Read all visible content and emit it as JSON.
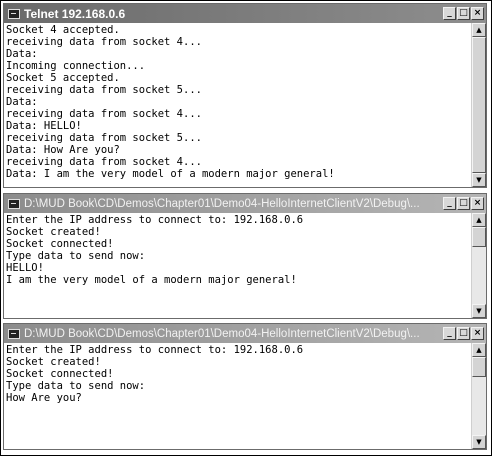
{
  "windows": [
    {
      "title": "Telnet 192.168.0.6",
      "state": "active",
      "lines": [
        "Socket 4 accepted.",
        "receiving data from socket 4...",
        "Data:",
        "Incoming connection...",
        "Socket 5 accepted.",
        "receiving data from socket 5...",
        "Data:",
        "receiving data from socket 4...",
        "Data: HELLO!",
        "receiving data from socket 5...",
        "Data: How Are you?",
        "receiving data from socket 4...",
        "Data: I am the very model of a modern major general!"
      ]
    },
    {
      "title": "D:\\MUD Book\\CD\\Demos\\Chapter01\\Demo04-HelloInternetClientV2\\Debug\\...",
      "state": "inactive",
      "lines": [
        "Enter the IP address to connect to: 192.168.0.6",
        "Socket created!",
        "Socket connected!",
        "Type data to send now:",
        "HELLO!",
        "I am the very model of a modern major general!"
      ]
    },
    {
      "title": "D:\\MUD Book\\CD\\Demos\\Chapter01\\Demo04-HelloInternetClientV2\\Debug\\...",
      "state": "inactive",
      "lines": [
        "Enter the IP address to connect to: 192.168.0.6",
        "Socket created!",
        "Socket connected!",
        "Type data to send now:",
        "How Are you?"
      ]
    }
  ],
  "buttons": {
    "minimize": "_",
    "maximize": "□",
    "close": "×"
  },
  "icons": {
    "system_menu": "console-icon",
    "scroll_up": "▲",
    "scroll_down": "▼"
  }
}
